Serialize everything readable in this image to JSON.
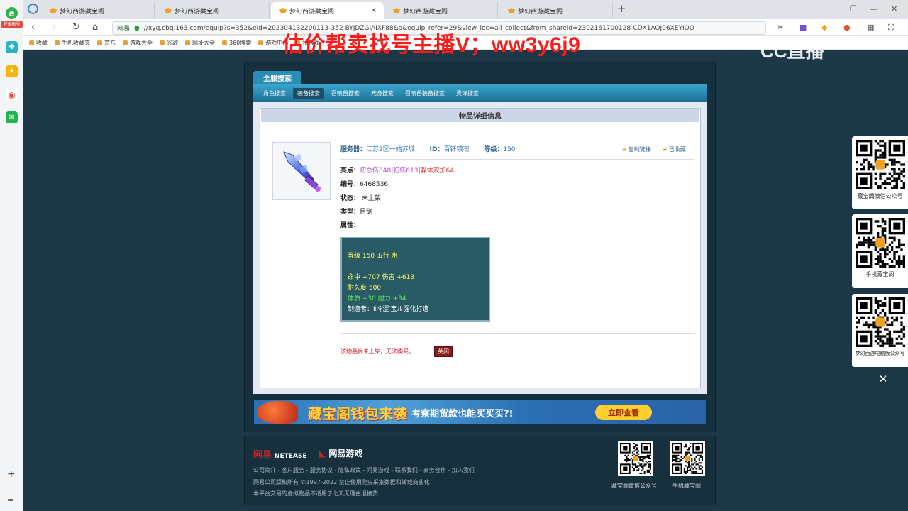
{
  "browser": {
    "tabs": [
      {
        "title": "梦幻西游藏宝阁",
        "active": false
      },
      {
        "title": "梦幻西游藏宝阁",
        "active": false
      },
      {
        "title": "梦幻西游藏宝阁",
        "active": true
      },
      {
        "title": "梦幻西游藏宝阁",
        "active": false
      },
      {
        "title": "梦幻西游藏宝阁",
        "active": false
      }
    ],
    "url_site": "网易",
    "url": "//xyq.cbg.163.com/equip?s=352&eid=202304132200113-352-BYJDZGJAIXF88&o&equip_refer=29&view_loc=all_collect&from_shareid=2302161700128-CDX1AOJ06XEYIOO",
    "login_badge": "登录账号",
    "bookmarks": [
      "收藏",
      "手机收藏夹",
      "京东",
      "游戏大全",
      "谷歌",
      "网址大全",
      "360搜索",
      "游戏中心",
      "找游戏"
    ]
  },
  "overlay": {
    "promo_text": "估价帮卖找号主播V；ww3y6j9",
    "stream_logo": "CC直播"
  },
  "page": {
    "header_tab": "全服搜索",
    "subnav": [
      "角色搜索",
      "装备搜索",
      "召唤兽搜索",
      "元身搜索",
      "召唤兽装备搜索",
      "灵饰搜索"
    ],
    "subnav_active": 1,
    "panel_title": "物品详细信息",
    "info": {
      "server_label": "服务器：",
      "server_value": "江苏2区一姑苏城",
      "id_label": "ID：",
      "id_value": "百钎镇魂",
      "level_label": "等级：",
      "level_value": "150",
      "copy_link": "复制链接",
      "favorited": "已收藏"
    },
    "details": {
      "highlights_label": "亮点：",
      "highlight_1": "初总伤848",
      "highlight_2": "初伤613",
      "highlight_3": "躲体双加64",
      "serial_label": "编号：",
      "serial_value": "6468536",
      "status_label": "状态：",
      "status_value": "未上架",
      "type_label": "类型：",
      "type_value": "巨剑",
      "attr_label": "属性："
    },
    "stats": {
      "line1": "等级 150  五行 水",
      "line2": "命中 +707  伤害 +613",
      "line3": "耐久度 500",
      "line4": "体质 +30  耐力 +34",
      "line5": "制造者：Ⅱ冷涩′宝ル强化打造"
    },
    "notice": "该物品尚未上架，无法购买。",
    "close_button": "关闭",
    "banner_big": "藏宝阁钱包来袭",
    "banner_small": "考察期货款也能买买买?!",
    "banner_cta": "立即查看"
  },
  "footer": {
    "netease": "网易",
    "netease_en": "NETEASE",
    "netgame": "网易游戏",
    "links": "公司简介 - 客户服务 - 服务协议 - 隐私政策 - 问易游戏 - 联系我们 - 商务合作 - 加入我们",
    "copyright": "网易公司版权所有 ©1997-2022  禁止使用爬虫采集数据和转载商业化",
    "disclaimer": "本平台交易的虚拟物品不适用于七天无理由退换货",
    "qr1_label": "藏宝阁微信公众号",
    "qr2_label": "手机藏宝阁"
  },
  "side_qr": [
    {
      "label": "藏宝阁微信公众号"
    },
    {
      "label": "手机藏宝阁"
    },
    {
      "label": "梦幻西游电脑版公众号"
    }
  ],
  "colors": {
    "page_bg": "#1c3847",
    "accent_blue": "#2a8db8",
    "highlight_purple": "#b04fd4",
    "highlight_red": "#d93a3a",
    "overlay_red": "#ff1a1a"
  }
}
